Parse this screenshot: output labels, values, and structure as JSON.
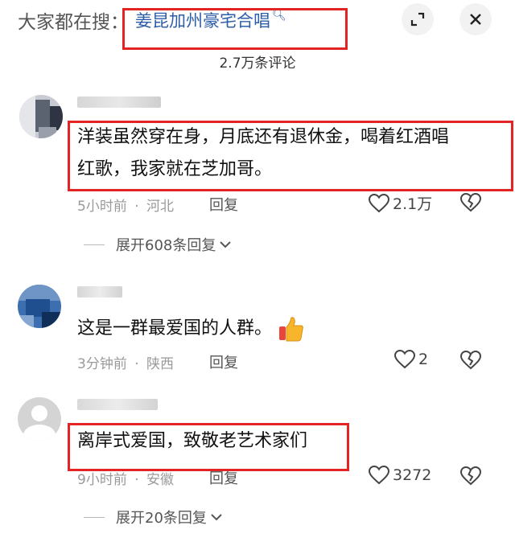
{
  "header": {
    "prefix": "大家都在搜：",
    "query": "姜昆加州豪宅合唱",
    "search_icon": "search-icon",
    "expand_icon": "expand-icon",
    "close_icon": "close-icon",
    "comment_count": "2.7万条评论"
  },
  "accent_colors": {
    "highlight_box": "#e32424",
    "query_text": "#2d5ea8"
  },
  "comments": [
    {
      "text_line1": "洋装虽然穿在身，月底还有退休金，喝着红酒唱",
      "text_line2": "红歌，我家就在芝加哥。",
      "time": "5小时前",
      "location": "河北",
      "reply_label": "回复",
      "likes": "2.1万",
      "expand_label": "展开608条回复"
    },
    {
      "text": "这是一群最爱国的人群。",
      "emoji": "thumbs-up-emoji",
      "time": "3分钟前",
      "location": "陕西",
      "reply_label": "回复",
      "likes": "2"
    },
    {
      "text": "离岸式爱国，致敬老艺术家们",
      "time": "9小时前",
      "location": "安徽",
      "reply_label": "回复",
      "likes": "3272",
      "expand_label": "展开20条回复"
    }
  ],
  "separator": "·"
}
